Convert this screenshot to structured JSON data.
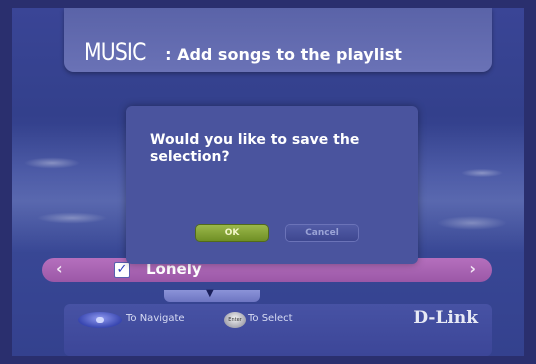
{
  "header": {
    "app_name": "MUSIC",
    "subtitle": ": Add songs to the playlist"
  },
  "dialog": {
    "message": "Would you like to save the selection?",
    "ok_label": "OK",
    "cancel_label": "Cancel"
  },
  "list": {
    "items": [
      {
        "label": "Lonely",
        "checked": true
      }
    ],
    "left_arrow": "‹",
    "right_arrow": "›"
  },
  "footer": {
    "navigate_label": "To Navigate",
    "enter_icon_text": "Enter",
    "select_label": "To Select",
    "brand": "D-Link"
  },
  "colors": {
    "background": "#3a4596",
    "ok_button": "#7fa235",
    "highlight_row": "#a862b1"
  }
}
